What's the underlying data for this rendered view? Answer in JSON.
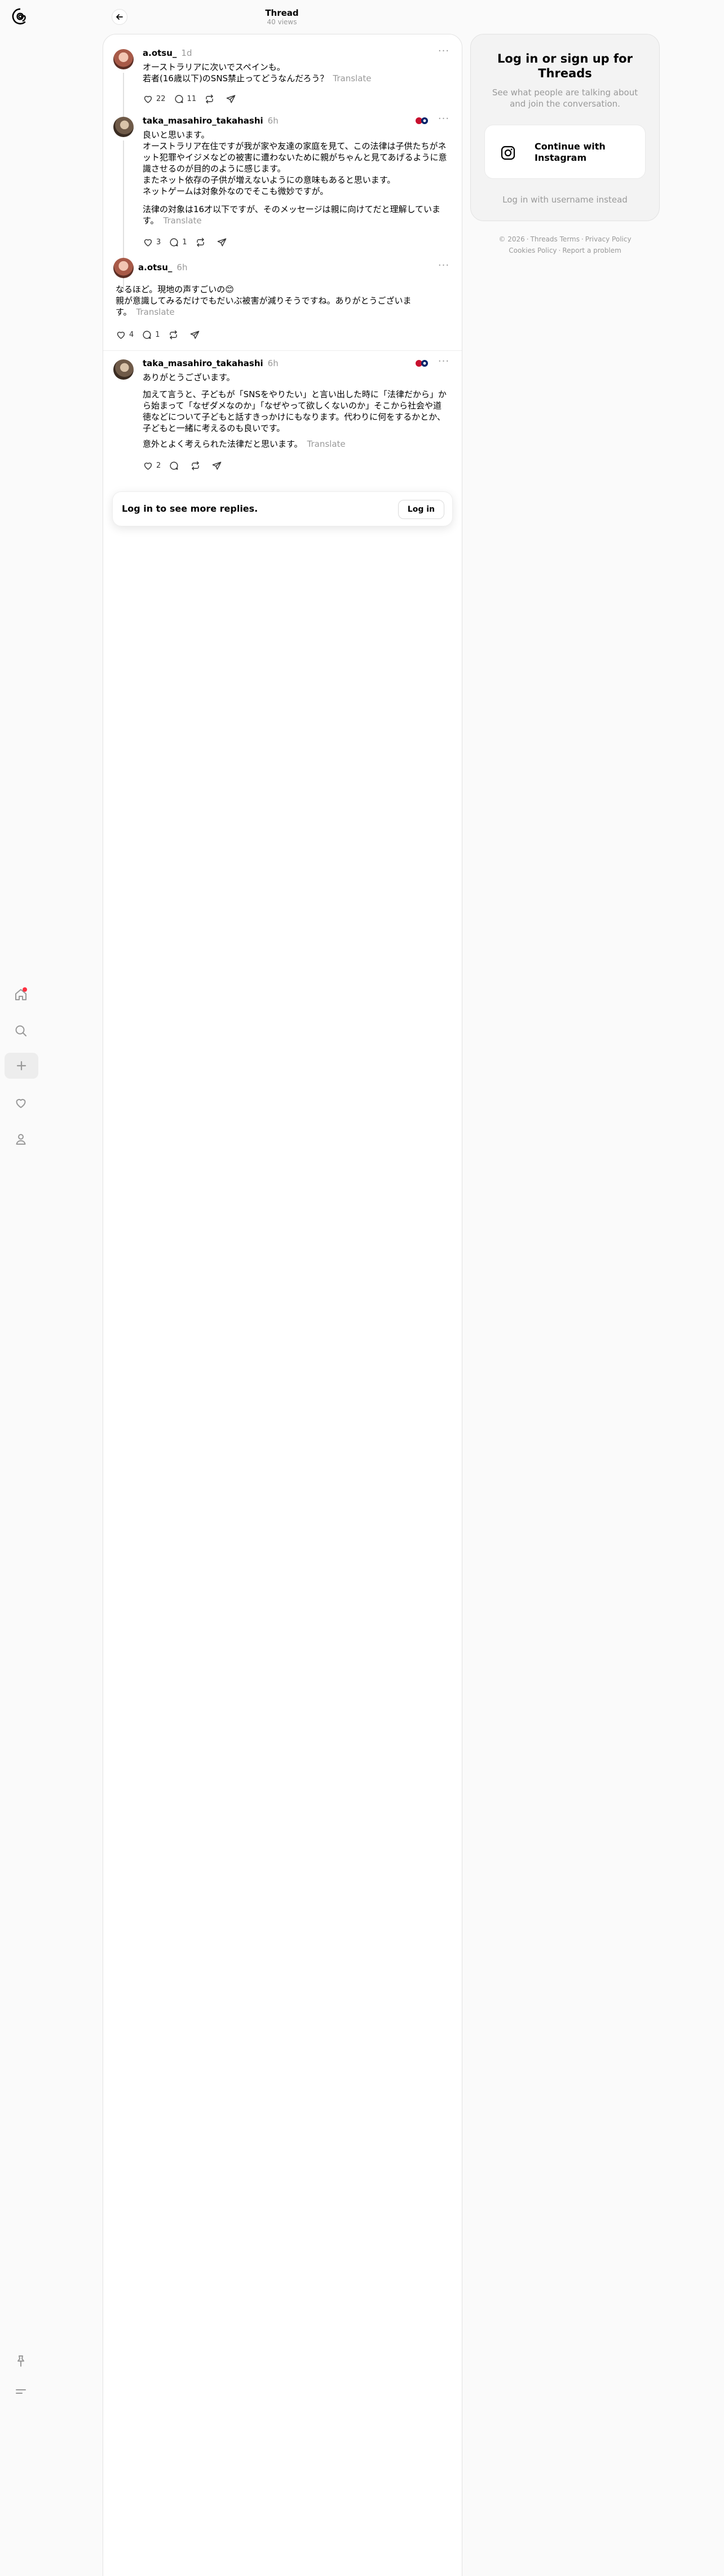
{
  "header": {
    "title": "Thread",
    "views": "40 views"
  },
  "posts": [
    {
      "username": "a.otsu_",
      "time": "1d",
      "text": "オーストラリアに次いでスペインも。\n若者(16歳以下)のSNS禁止ってどうなんだろう？",
      "translate": "Translate",
      "likes": "22",
      "replies": "11"
    },
    {
      "username": "taka_masahiro_takahashi",
      "time": "6h",
      "text": "良いと思います。\nオーストラリア在住ですが我が家や友達の家庭を見て、この法律は子供たちがネット犯罪やイジメなどの被害に遭わないために親がちゃんと見てあげるように意識させるのが目的のように感じます。\nまたネット依存の子供が増えないようにの意味もあると思います。\nネットゲームは対象外なのでそこも微妙ですが。",
      "text2": "法律の対象は16才以下ですが、そのメッセージは親に向けてだと理解しています。",
      "translate": "Translate",
      "likes": "3",
      "replies": "1"
    },
    {
      "username": "a.otsu_",
      "time": "6h",
      "text": "なるほど。現地の声すごいの😊\n親が意識してみるだけでもだいぶ被害が減りそうですね。ありがとうございます。",
      "translate": "Translate",
      "likes": "4",
      "replies": "1"
    },
    {
      "username": "taka_masahiro_takahashi",
      "time": "6h",
      "text": "ありがとうございます。",
      "text2": "加えて言うと、子どもが「SNSをやりたい」と言い出した時に「法律だから」から始まって「なぜダメなのか」「なぜやって欲しくないのか」そこから社会や道徳などについて子どもと話すきっかけにもなります。代わりに何をするかとか、子どもと一緒に考えるのも良いです。",
      "text3": "意外とよく考えられた法律だと思います。",
      "translate": "Translate",
      "likes": "2",
      "replies": ""
    }
  ],
  "login_bar": {
    "text": "Log in to see more replies.",
    "button": "Log in"
  },
  "side": {
    "title": "Log in or sign up for Threads",
    "subtitle": "See what people are talking about and join the conversation.",
    "instagram_button": "Continue with Instagram",
    "alt_login": "Log in with username instead"
  },
  "footer": {
    "copyright": "© 2026",
    "terms": "Threads Terms",
    "privacy": "Privacy Policy",
    "cookies": "Cookies Policy",
    "report": "Report a problem"
  },
  "colors": {
    "accent_dot": "#ff3040",
    "muted_text": "#999999"
  }
}
